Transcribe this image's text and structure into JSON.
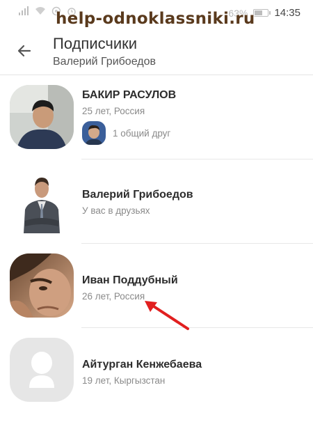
{
  "status_bar": {
    "battery": "63%",
    "battery_level": 0.63,
    "time": "14:35"
  },
  "watermark": "help-odnoklassniki.ru",
  "header": {
    "title": "Подписчики",
    "subtitle": "Валерий Грибоедов",
    "back_icon": "arrow-left-icon"
  },
  "subscribers": [
    {
      "name": "БАКИР РАСУЛОВ",
      "info": "25 лет, Россия",
      "mutual": "1 общий друг"
    },
    {
      "name": "Валерий Грибоедов",
      "info": "У вас в друзьях"
    },
    {
      "name": "Иван Поддубный",
      "info": "26 лет, Россия"
    },
    {
      "name": "Айтурган Кенжебаева",
      "info": "19 лет, Кыргызстан"
    }
  ],
  "colors": {
    "accent_arrow": "#e11f1f",
    "divider": "#e7e7e7",
    "placeholder_bg": "#e6e6e6"
  }
}
